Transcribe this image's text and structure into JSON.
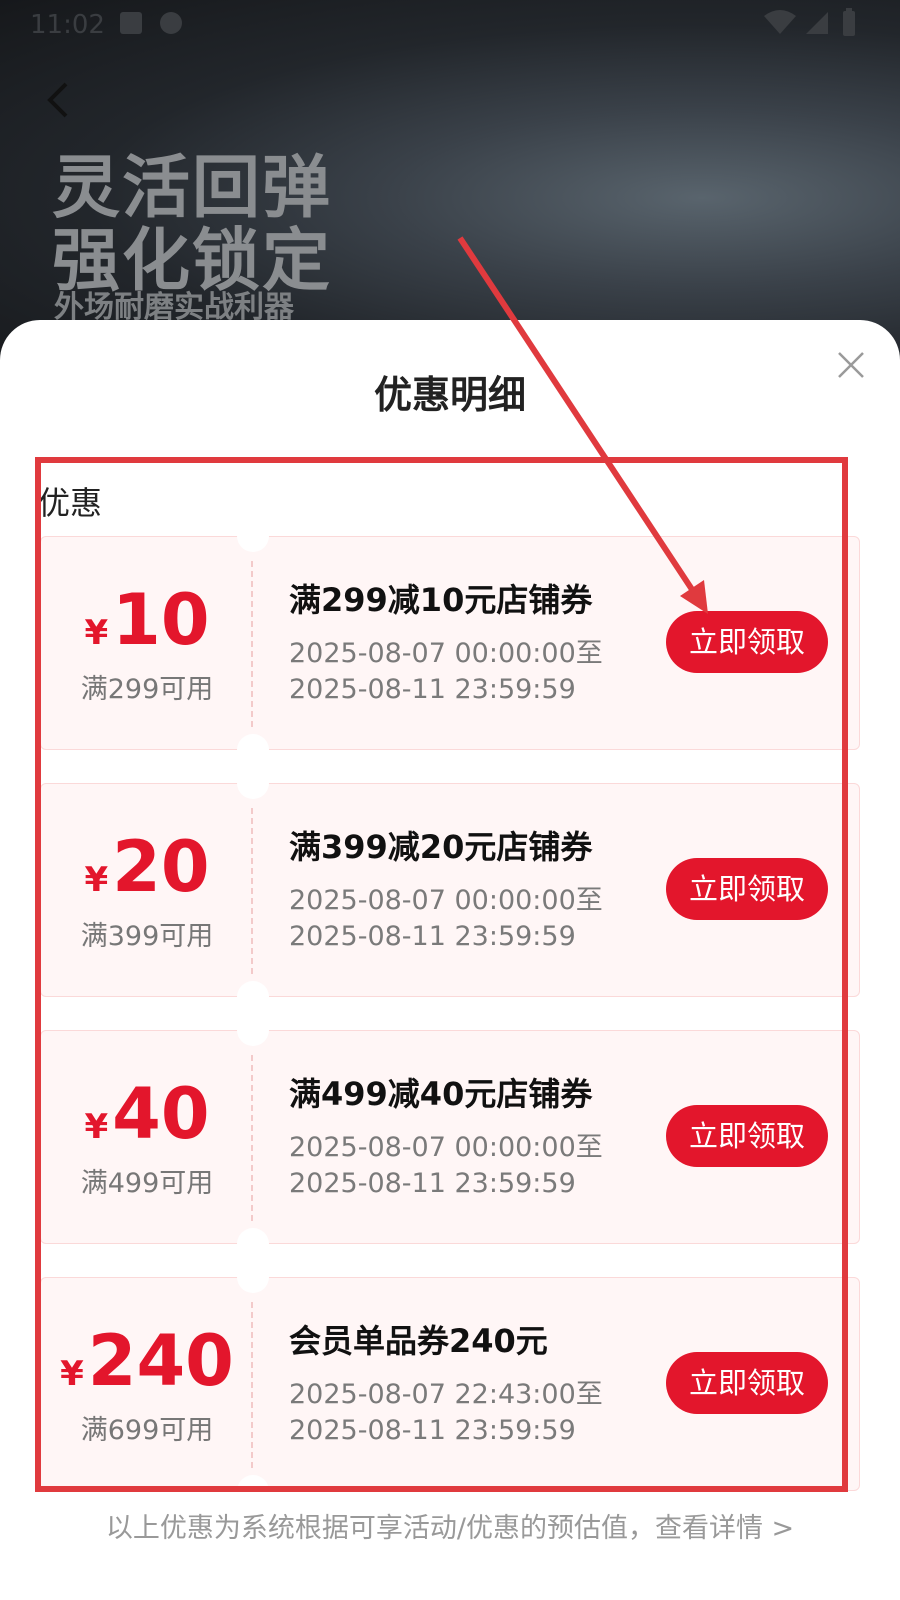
{
  "status_bar": {
    "time": "11:02"
  },
  "banner": {
    "line1": "灵活回弹",
    "line2": "强化锁定",
    "subline": "外场耐磨实战利器"
  },
  "sheet": {
    "title": "优惠明细",
    "section_label": "优惠",
    "footer_note": "以上优惠为系统根据可享活动/优惠的预估值，查看详情 >"
  },
  "coupons": [
    {
      "currency": "¥",
      "amount": "10",
      "threshold": "满299可用",
      "title": "满299减10元店铺券",
      "start": "2025-08-07 00:00:00至",
      "end": "2025-08-11 23:59:59",
      "button": "立即领取"
    },
    {
      "currency": "¥",
      "amount": "20",
      "threshold": "满399可用",
      "title": "满399减20元店铺券",
      "start": "2025-08-07 00:00:00至",
      "end": "2025-08-11 23:59:59",
      "button": "立即领取"
    },
    {
      "currency": "¥",
      "amount": "40",
      "threshold": "满499可用",
      "title": "满499减40元店铺券",
      "start": "2025-08-07 00:00:00至",
      "end": "2025-08-11 23:59:59",
      "button": "立即领取"
    },
    {
      "currency": "¥",
      "amount": "240",
      "threshold": "满699可用",
      "title": "会员单品券240元",
      "start": "2025-08-07 22:43:00至",
      "end": "2025-08-11 23:59:59",
      "button": "立即领取"
    }
  ],
  "icons": {
    "back": "back-arrow-icon",
    "close": "close-icon",
    "wifi": "wifi-icon",
    "signal": "signal-icon",
    "battery": "battery-icon"
  },
  "colors": {
    "accent": "#e3162c",
    "coupon_bg": "#fff6f6",
    "annotation": "#e03a3e"
  }
}
